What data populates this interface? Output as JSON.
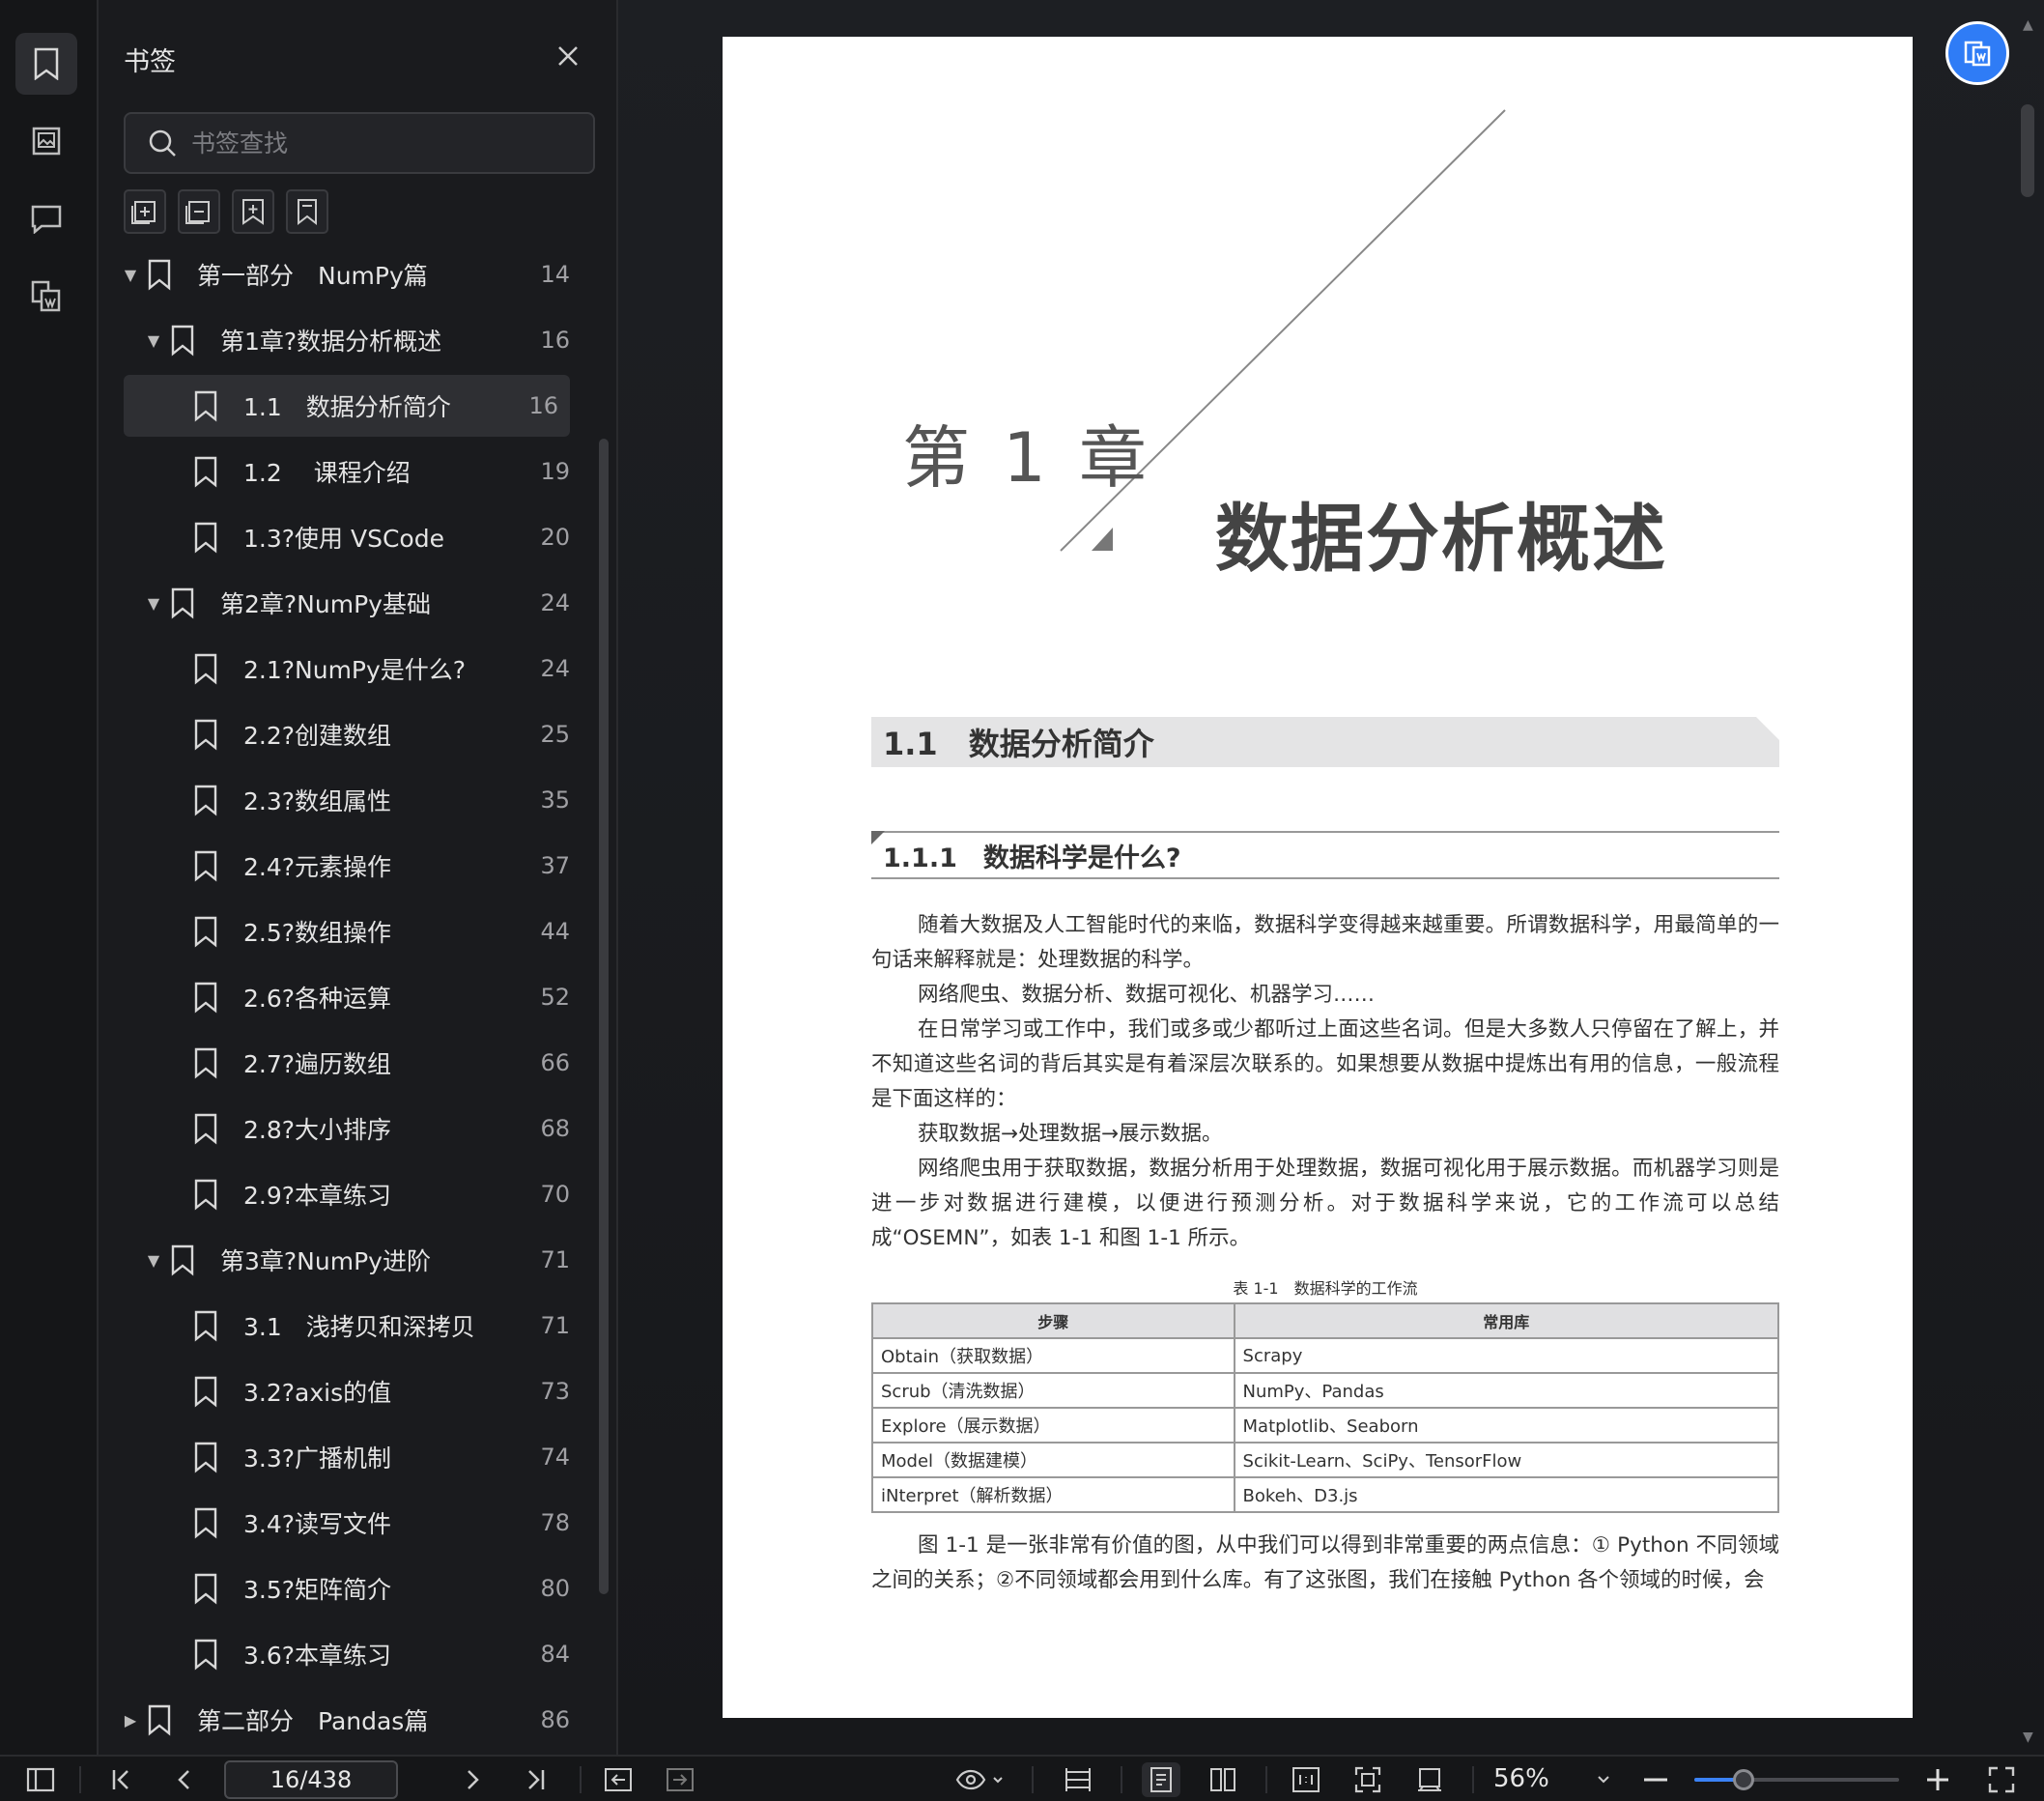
{
  "sidebar_panel": {
    "title": "书签",
    "search_placeholder": "书签查找"
  },
  "bookmarks": [
    {
      "label": "第一部分　NumPy篇",
      "page": "14",
      "level": 0,
      "expanded": true
    },
    {
      "label": "第1章?数据分析概述",
      "page": "16",
      "level": 1,
      "expanded": true
    },
    {
      "label": "1.1　数据分析简介",
      "page": "16",
      "level": 2,
      "selected": true
    },
    {
      "label": "1.2　 课程介绍",
      "page": "19",
      "level": 2
    },
    {
      "label": "1.3?使用 VSCode",
      "page": "20",
      "level": 2
    },
    {
      "label": "第2章?NumPy基础",
      "page": "24",
      "level": 1,
      "expanded": true
    },
    {
      "label": "2.1?NumPy是什么?",
      "page": "24",
      "level": 2
    },
    {
      "label": "2.2?创建数组",
      "page": "25",
      "level": 2
    },
    {
      "label": "2.3?数组属性",
      "page": "35",
      "level": 2
    },
    {
      "label": "2.4?元素操作",
      "page": "37",
      "level": 2
    },
    {
      "label": "2.5?数组操作",
      "page": "44",
      "level": 2
    },
    {
      "label": "2.6?各种运算",
      "page": "52",
      "level": 2
    },
    {
      "label": "2.7?遍历数组",
      "page": "66",
      "level": 2
    },
    {
      "label": "2.8?大小排序",
      "page": "68",
      "level": 2
    },
    {
      "label": "2.9?本章练习",
      "page": "70",
      "level": 2
    },
    {
      "label": "第3章?NumPy进阶",
      "page": "71",
      "level": 1,
      "expanded": true
    },
    {
      "label": "3.1　浅拷贝和深拷贝",
      "page": "71",
      "level": 2
    },
    {
      "label": "3.2?axis的值",
      "page": "73",
      "level": 2
    },
    {
      "label": "3.3?广播机制",
      "page": "74",
      "level": 2
    },
    {
      "label": "3.4?读写文件",
      "page": "78",
      "level": 2
    },
    {
      "label": "3.5?矩阵简介",
      "page": "80",
      "level": 2
    },
    {
      "label": "3.6?本章练习",
      "page": "84",
      "level": 2
    },
    {
      "label": "第二部分　Pandas篇",
      "page": "86",
      "level": 0,
      "expanded": false
    }
  ],
  "document": {
    "chapter_label": "第 1 章",
    "chapter_title": "数据分析概述",
    "section_title": "1.1　数据分析简介",
    "subsection_title": "1.1.1　数据科学是什么?",
    "paragraphs": [
      "随着大数据及人工智能时代的来临，数据科学变得越来越重要。所谓数据科学，用最简单的一句话来解释就是：处理数据的科学。",
      "网络爬虫、数据分析、数据可视化、机器学习……",
      "在日常学习或工作中，我们或多或少都听过上面这些名词。但是大多数人只停留在了解上，并不知道这些名词的背后其实是有着深层次联系的。如果想要从数据中提炼出有用的信息，一般流程是下面这样的：",
      "获取数据→处理数据→展示数据。",
      "网络爬虫用于获取数据，数据分析用于处理数据，数据可视化用于展示数据。而机器学习则是进一步对数据进行建模，以便进行预测分析。对于数据科学来说，它的工作流可以总结成“OSEMN”，如表 1-1 和图 1-1 所示。"
    ],
    "table_caption": "表 1-1　数据科学的工作流",
    "table_headers": [
      "步骤",
      "常用库"
    ],
    "table_rows": [
      [
        "Obtain（获取数据）",
        "Scrapy"
      ],
      [
        "Scrub（清洗数据）",
        "NumPy、Pandas"
      ],
      [
        "Explore（展示数据）",
        "Matplotlib、Seaborn"
      ],
      [
        "Model（数据建模）",
        "Scikit-Learn、SciPy、TensorFlow"
      ],
      [
        "iNterpret（解析数据）",
        "Bokeh、D3.js"
      ]
    ],
    "paragraph_after": "图 1-1 是一张非常有价值的图，从中我们可以得到非常重要的两点信息：① Python 不同领域之间的关系；②不同领域都会用到什么库。有了这张图，我们在接触 Python 各个领域的时候，会"
  },
  "toolbar": {
    "page_indicator": "16/438",
    "zoom_label": "56%",
    "zoom_fraction": 0.24
  },
  "colors": {
    "accent": "#2f7cf6",
    "panel_bg": "#1a1b1e",
    "selected_row": "#2e2f33"
  }
}
